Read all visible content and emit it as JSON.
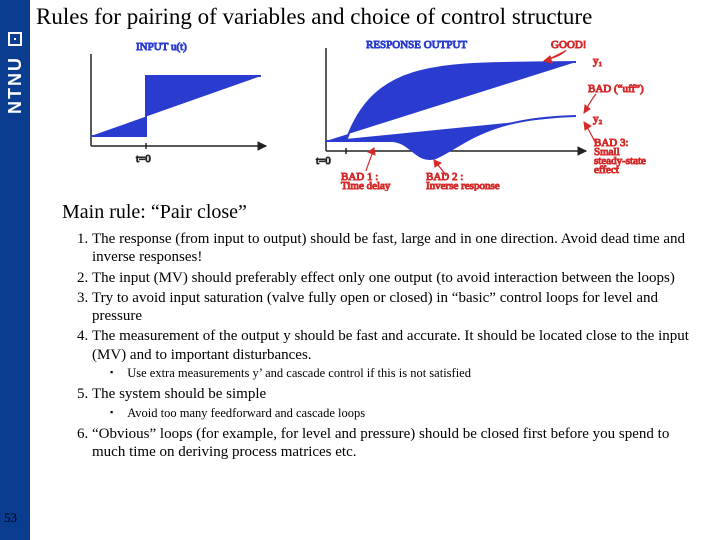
{
  "sidebar": {
    "brand": "NTNU"
  },
  "title": "Rules for pairing of variables and choice of control structure",
  "main_rule": "Main rule: “Pair close”",
  "rules": {
    "r1": "The response (from input to output) should be fast, large and in one direction. Avoid dead time and inverse responses!",
    "r2": "The input (MV) should preferably effect only one output (to avoid interaction between the loops)",
    "r3": "Try to avoid input saturation (valve fully open or closed) in “basic” control loops for level and pressure",
    "r4": "The measurement of the output y should be fast and accurate. It should be located close to the input (MV) and to important disturbances.",
    "r4_sub": "Use extra measurements y’ and cascade control if this is not satisfied",
    "r5": "The system should be simple",
    "r5_sub": "Avoid too many feedforward and cascade loops",
    "r6": "“Obvious” loops (for example, for level and pressure) should be closed first before you spend to much time on deriving process matrices etc."
  },
  "diagram_left": {
    "title": "INPUT u(t)",
    "t0": "t=0"
  },
  "diagram_right": {
    "title": "RESPONSE OUTPUT",
    "good": "GOOD!",
    "y1": "y₁",
    "bad_uff": "BAD (“uff”)",
    "y2": "y₂",
    "bad1": "BAD 1 :\nTime delay",
    "bad2": "BAD 2 :\nInverse response",
    "bad3": "BAD 3:\nSmall\nsteady-state\neffect",
    "t0": "t=0"
  },
  "page_number": "53"
}
